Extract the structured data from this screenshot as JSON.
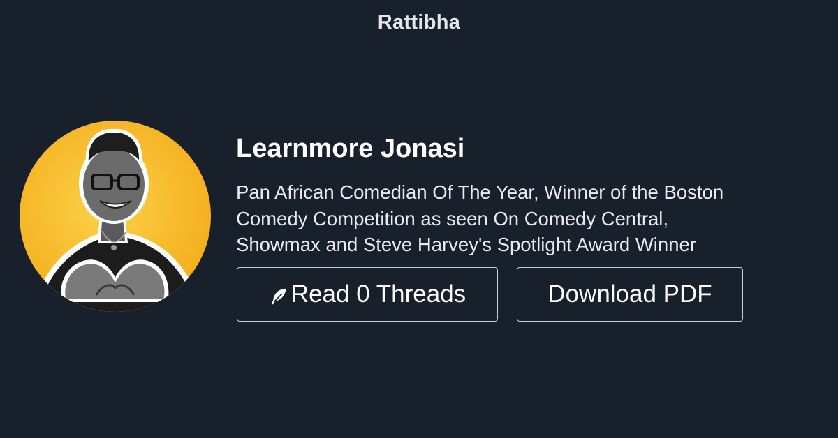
{
  "header": {
    "brand": "Rattibha"
  },
  "profile": {
    "name": "Learnmore Jonasi",
    "bio_lines": [
      "Pan African Comedian Of The Year, Winner of the Boston",
      "Comedy Competition as seen On Comedy Central,",
      "Showmax and Steve Harvey's Spotlight Award Winner"
    ],
    "avatar_alt": "avatar"
  },
  "actions": {
    "read_label": "Read 0 Threads",
    "read_icon": "feather-icon",
    "download_label": "Download PDF"
  },
  "colors": {
    "background": "#17202b",
    "avatar_bg": "#f5b120",
    "button_border": "#c8cdd2",
    "text": "#ffffff"
  }
}
